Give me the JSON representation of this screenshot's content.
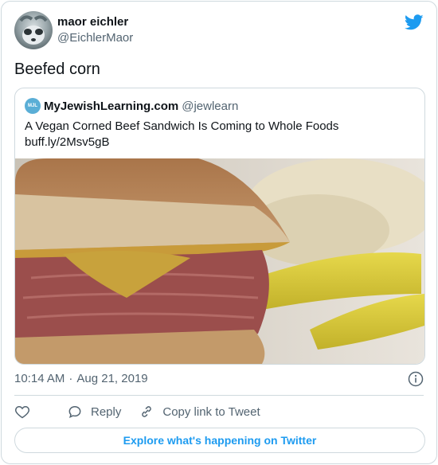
{
  "author": {
    "display_name": "maor eichler",
    "handle": "@EichlerMaor"
  },
  "tweet": {
    "text": "Beefed corn",
    "timestamp_time": "10:14 AM",
    "timestamp_sep": "·",
    "timestamp_date": "Aug 21, 2019"
  },
  "quote": {
    "avatar_text": "MJL",
    "name": "MyJewishLearning.com",
    "handle": "@jewlearn",
    "text": "A Vegan Corned Beef Sandwich Is Coming to Whole Foods",
    "link": "buff.ly/2Msv5gB"
  },
  "actions": {
    "reply_label": "Reply",
    "copy_label": "Copy link to Tweet"
  },
  "footer": {
    "explore_label": "Explore what's happening on Twitter"
  },
  "colors": {
    "accent": "#1d9bf0",
    "secondary_text": "#536471",
    "border": "#cfd9de"
  },
  "icons": [
    "twitter-bird-icon",
    "info-icon",
    "heart-icon",
    "reply-icon",
    "link-icon"
  ]
}
